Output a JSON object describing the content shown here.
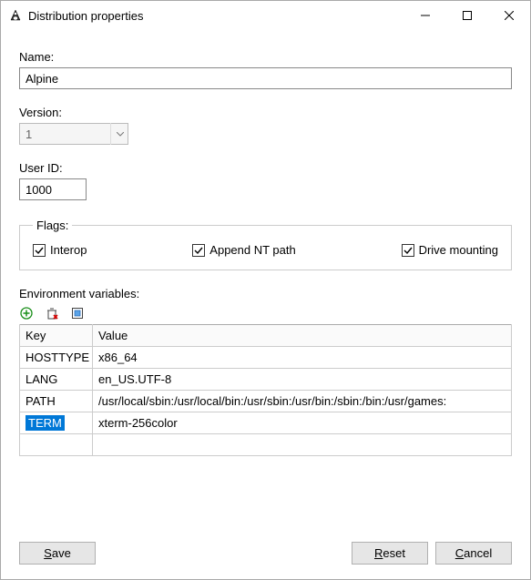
{
  "window": {
    "title": "Distribution properties"
  },
  "labels": {
    "name": "Name:",
    "version": "Version:",
    "userId": "User ID:",
    "flags": "Flags:",
    "env": "Environment variables:",
    "keyHeader": "Key",
    "valueHeader": "Value"
  },
  "fields": {
    "name": "Alpine",
    "version": "1",
    "userId": "1000"
  },
  "flags": {
    "interop": {
      "label": "Interop",
      "checked": true
    },
    "appendNt": {
      "label": "Append NT path",
      "checked": true
    },
    "driveMount": {
      "label": "Drive mounting",
      "checked": true
    }
  },
  "env": [
    {
      "key": "HOSTTYPE",
      "value": "x86_64",
      "selected": false
    },
    {
      "key": "LANG",
      "value": "en_US.UTF-8",
      "selected": false
    },
    {
      "key": "PATH",
      "value": "/usr/local/sbin:/usr/local/bin:/usr/sbin:/usr/bin:/sbin:/bin:/usr/games:",
      "selected": false
    },
    {
      "key": "TERM",
      "value": "xterm-256color",
      "selected": true
    }
  ],
  "buttons": {
    "save": "Save",
    "reset": "Reset",
    "cancel": "Cancel"
  },
  "icons": {
    "add": "add-icon",
    "delete": "delete-icon",
    "edit": "edit-icon"
  }
}
